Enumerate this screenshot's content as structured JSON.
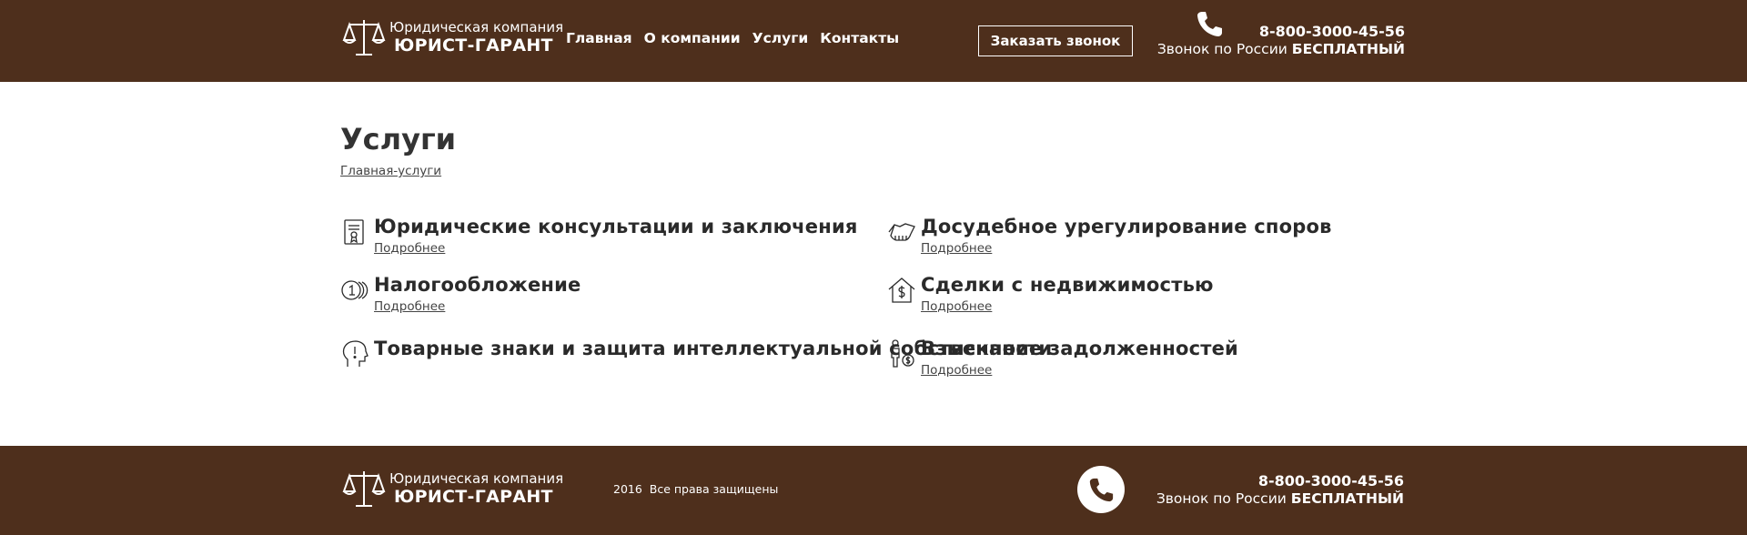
{
  "brand": {
    "subtitle": "Юридическая компания",
    "name": "ЮРИСТ-ГАРАНТ"
  },
  "nav": {
    "items": [
      "Главная",
      "О компании",
      "Услуги",
      "Контакты"
    ]
  },
  "header": {
    "callback_label": "Заказать звонок"
  },
  "contact": {
    "phone": "8-800-3000-45-56",
    "free_prefix": "Звонок по России",
    "free_word": "БЕСПЛАТНЫЙ"
  },
  "page": {
    "title": "Услуги",
    "breadcrumb": "Главная-услуги"
  },
  "services": [
    {
      "title": "Юридические консультации и заключения",
      "more": "Подробнее",
      "icon": "document-icon"
    },
    {
      "title": "Досудебное урегулирование споров",
      "more": "Подробнее",
      "icon": "handshake-icon"
    },
    {
      "title": "Налогообложение",
      "more": "Подробнее",
      "icon": "coins-icon"
    },
    {
      "title": "Сделки с недвижимостью",
      "more": "Подробнее",
      "icon": "house-dollar-icon"
    },
    {
      "title": "Товарные знаки и защита интеллектуальной собственности",
      "more": "",
      "icon": "head-idea-icon"
    },
    {
      "title": "Взыскание задолженностей",
      "more": "Подробнее",
      "icon": "person-debt-icon"
    }
  ],
  "footer": {
    "year": "2016",
    "rights": "Все права защищены"
  },
  "colors": {
    "brand_brown": "#4e2f1c",
    "white": "#ffffff",
    "text_dark": "#2a2a2a"
  }
}
